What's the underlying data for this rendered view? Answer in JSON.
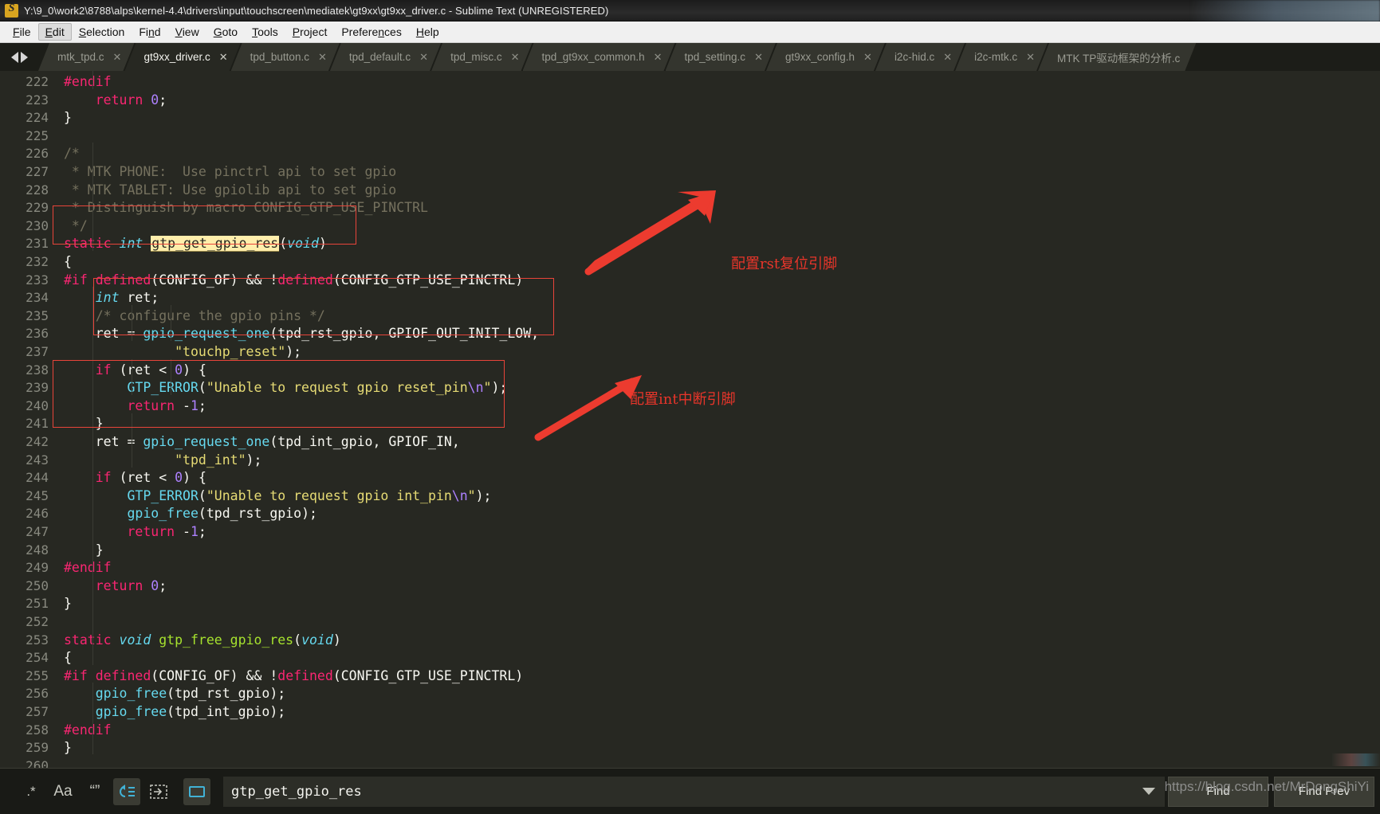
{
  "window": {
    "title": "Y:\\9_0\\work2\\8788\\alps\\kernel-4.4\\drivers\\input\\touchscreen\\mediatek\\gt9xx\\gt9xx_driver.c - Sublime Text (UNREGISTERED)",
    "logo_letter": "S"
  },
  "menubar": {
    "items": [
      {
        "label": "File",
        "accel": "F"
      },
      {
        "label": "Edit",
        "accel": "E"
      },
      {
        "label": "Selection",
        "accel": "S"
      },
      {
        "label": "Find",
        "accel": "n"
      },
      {
        "label": "View",
        "accel": "V"
      },
      {
        "label": "Goto",
        "accel": "G"
      },
      {
        "label": "Tools",
        "accel": "T"
      },
      {
        "label": "Project",
        "accel": "P"
      },
      {
        "label": "Preferences",
        "accel": "n"
      },
      {
        "label": "Help",
        "accel": "H"
      }
    ]
  },
  "tabs": {
    "close_glyph": "✕",
    "items": [
      {
        "label": "mtk_tpd.c",
        "active": false,
        "closable": true
      },
      {
        "label": "gt9xx_driver.c",
        "active": true,
        "closable": true
      },
      {
        "label": "tpd_button.c",
        "active": false,
        "closable": true
      },
      {
        "label": "tpd_default.c",
        "active": false,
        "closable": true
      },
      {
        "label": "tpd_misc.c",
        "active": false,
        "closable": true
      },
      {
        "label": "tpd_gt9xx_common.h",
        "active": false,
        "closable": true
      },
      {
        "label": "tpd_setting.c",
        "active": false,
        "closable": true
      },
      {
        "label": "gt9xx_config.h",
        "active": false,
        "closable": true
      },
      {
        "label": "i2c-hid.c",
        "active": false,
        "closable": true
      },
      {
        "label": "i2c-mtk.c",
        "active": false,
        "closable": true
      },
      {
        "label": "MTK TP驱动框架的分析.c",
        "active": false,
        "closable": false
      }
    ]
  },
  "editor": {
    "first_line": 222,
    "last_line": 260,
    "cursor_line": 231,
    "search_highlight": "gtp_get_gpio_res",
    "lines": [
      {
        "n": 222,
        "text": "#endif"
      },
      {
        "n": 223,
        "text": "    return 0;"
      },
      {
        "n": 224,
        "text": "}"
      },
      {
        "n": 225,
        "text": ""
      },
      {
        "n": 226,
        "text": "/*"
      },
      {
        "n": 227,
        "text": " * MTK PHONE:  Use pinctrl api to set gpio"
      },
      {
        "n": 228,
        "text": " * MTK TABLET: Use gpiolib api to set gpio"
      },
      {
        "n": 229,
        "text": " * Distinguish by macro CONFIG_GTP_USE_PINCTRL"
      },
      {
        "n": 230,
        "text": " */"
      },
      {
        "n": 231,
        "text": "static int gtp_get_gpio_res(void)"
      },
      {
        "n": 232,
        "text": "{"
      },
      {
        "n": 233,
        "text": "#if defined(CONFIG_OF) && !defined(CONFIG_GTP_USE_PINCTRL)"
      },
      {
        "n": 234,
        "text": "    int ret;"
      },
      {
        "n": 235,
        "text": "    /* configure the gpio pins */"
      },
      {
        "n": 236,
        "text": "    ret = gpio_request_one(tpd_rst_gpio, GPIOF_OUT_INIT_LOW,"
      },
      {
        "n": 237,
        "text": "              \"touchp_reset\");"
      },
      {
        "n": 238,
        "text": "    if (ret < 0) {"
      },
      {
        "n": 239,
        "text": "        GTP_ERROR(\"Unable to request gpio reset_pin\\n\");"
      },
      {
        "n": 240,
        "text": "        return -1;"
      },
      {
        "n": 241,
        "text": "    }"
      },
      {
        "n": 242,
        "text": "    ret = gpio_request_one(tpd_int_gpio, GPIOF_IN,"
      },
      {
        "n": 243,
        "text": "              \"tpd_int\");"
      },
      {
        "n": 244,
        "text": "    if (ret < 0) {"
      },
      {
        "n": 245,
        "text": "        GTP_ERROR(\"Unable to request gpio int_pin\\n\");"
      },
      {
        "n": 246,
        "text": "        gpio_free(tpd_rst_gpio);"
      },
      {
        "n": 247,
        "text": "        return -1;"
      },
      {
        "n": 248,
        "text": "    }"
      },
      {
        "n": 249,
        "text": "#endif"
      },
      {
        "n": 250,
        "text": "    return 0;"
      },
      {
        "n": 251,
        "text": "}"
      },
      {
        "n": 252,
        "text": ""
      },
      {
        "n": 253,
        "text": "static void gtp_free_gpio_res(void)"
      },
      {
        "n": 254,
        "text": "{"
      },
      {
        "n": 255,
        "text": "#if defined(CONFIG_OF) && !defined(CONFIG_GTP_USE_PINCTRL)"
      },
      {
        "n": 256,
        "text": "    gpio_free(tpd_rst_gpio);"
      },
      {
        "n": 257,
        "text": "    gpio_free(tpd_int_gpio);"
      },
      {
        "n": 258,
        "text": "#endif"
      },
      {
        "n": 259,
        "text": "}"
      },
      {
        "n": 260,
        "text": ""
      }
    ]
  },
  "annotations": {
    "color": "#e8352a",
    "notes": [
      {
        "text": "配置rst复位引脚"
      },
      {
        "text": "配置int中断引脚"
      }
    ]
  },
  "findbar": {
    "regex_label": ".*",
    "case_label": "Aa",
    "whole_word_label": "“”",
    "wrap_label": "wrap-icon",
    "in_selection_label": "in-selection-icon",
    "highlight_label": "highlight-matches-icon",
    "query": "gtp_get_gpio_res",
    "placeholder": "Find",
    "find_label": "Find",
    "find_prev_label": "Find Prev"
  },
  "watermark": {
    "text": "https://blog.csdn.net/MrDongShiYi"
  }
}
